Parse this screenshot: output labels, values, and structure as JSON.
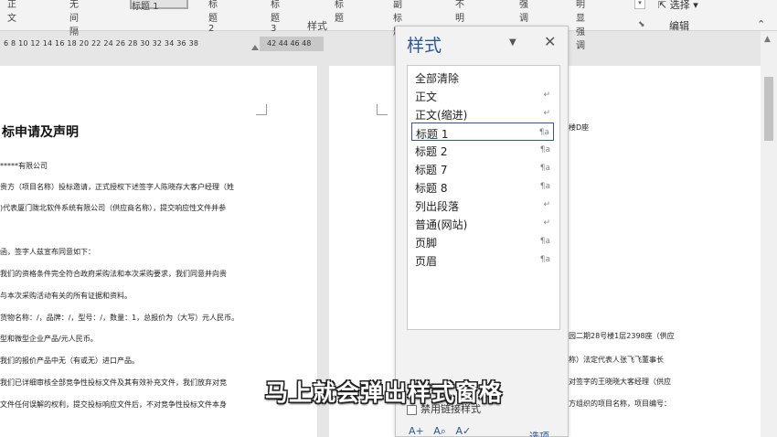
{
  "ribbon": {
    "styles_group_label": "样式",
    "editing_group_label": "编辑",
    "select_label": "选择",
    "style_cells": [
      "正文",
      "无间隔",
      "标题 1",
      "标题 2",
      "标题 3",
      "标题",
      "副标题",
      "不明显强调",
      "强调",
      "明显强调"
    ]
  },
  "ruler": {
    "ticks": "6   8  10  12  14  16  18  20  22  24  26  28  30  32  34  36  38",
    "ticks_margin": "42  44  46  48"
  },
  "document_left": {
    "title": "标申请及声明",
    "lines": [
      "*****有限公司",
      "贵方（项目名称）投标邀请，正式授权下述签字人陈晓存大客户经理（姓",
      ")代表厦门陇北软件系统有限公司（供应商名称），提交响应性文件并参",
      "",
      "函，签字人兹宣布同意如下：",
      "我们的资格条件完全符合政府采购法和本次采购要求，我们同意并向贵",
      "与本次采购活动有关的所有证据和资料。",
      "货物名称：/，品牌：/，型号：/，数量：1，总报价为（大写）元人民币。",
      "型和微型企业产品/元人民币。",
      "我们的报价产品中无（有或无）进口产品。",
      "我们已详细审核全部竞争性投标文件及其有效补充文件，我们放弃对竞",
      "文件任何误解的权利，提交投标响应文件后，不对竞争性投标文件本身"
    ]
  },
  "document_right": {
    "lines": [
      "楼D座",
      "园二期28号楼1层2398座（供应",
      "称）法定代表人张飞飞董事长",
      "对签字的王晓晓大客经理（供应",
      "方组织的项目名称，项目编号："
    ]
  },
  "styles_pane": {
    "title": "样式",
    "items": [
      {
        "label": "全部清除",
        "icon": ""
      },
      {
        "label": "正文",
        "icon": "↵"
      },
      {
        "label": "正文(缩进)",
        "icon": "↵"
      },
      {
        "label": "标题 1",
        "icon": "¶a"
      },
      {
        "label": "标题 2",
        "icon": "¶a"
      },
      {
        "label": "标题 7",
        "icon": "¶a"
      },
      {
        "label": "标题 8",
        "icon": "¶a"
      },
      {
        "label": "列出段落",
        "icon": "↵"
      },
      {
        "label": "普通(网站)",
        "icon": "↵"
      },
      {
        "label": "页脚",
        "icon": "¶a"
      },
      {
        "label": "页眉",
        "icon": "¶a"
      }
    ],
    "selected_index": 3,
    "linked_styles_label": "禁用链接样式",
    "options_label": "选项..."
  },
  "caption": "马上就会弹出样式窗格",
  "colors": {
    "accent": "#2b579a",
    "pane_bg": "#f2f2f2",
    "canvas_bg": "#e6e6e6"
  }
}
